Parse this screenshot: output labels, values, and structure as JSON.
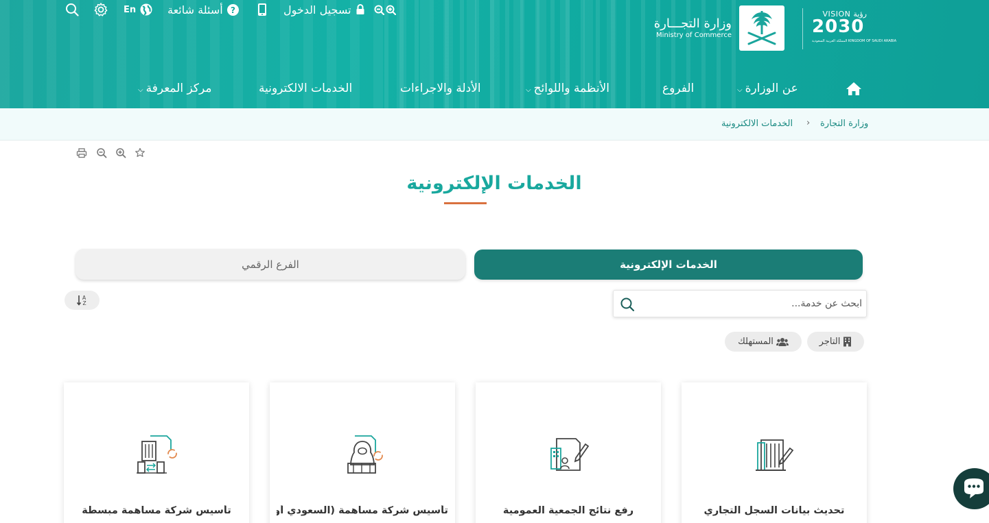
{
  "topbar": {
    "login_label": "تسجيل الدخول",
    "faq_label": "أسئلة شائعة",
    "language_label": "En"
  },
  "logo": {
    "ministry_ar": "وزارة التجـــارة",
    "ministry_en": "Ministry of Commerce",
    "vision_label": "VISION رؤية",
    "vision_year": "2030",
    "vision_kingdom": "المملكة العربية السعودية KINGDOM OF SAUDI ARABIA"
  },
  "nav": {
    "items": [
      {
        "label": "عن الوزارة"
      },
      {
        "label": "الفروع"
      },
      {
        "label": "الأنظمة واللوائح"
      },
      {
        "label": "الأدلة والاجراءات"
      },
      {
        "label": "الخدمات الالكترونية"
      },
      {
        "label": "مركز المعرفة"
      }
    ]
  },
  "breadcrumb": {
    "home": "وزارة التجارة",
    "current": "الخدمات الالكترونية"
  },
  "page": {
    "title": "الخدمات الإلكترونية"
  },
  "tabs": {
    "active": "الخدمات الإلكترونية",
    "inactive": "الفرع الرقمي"
  },
  "search": {
    "placeholder": "ابحث عن خدمة..."
  },
  "sort": {
    "label": "AZ"
  },
  "filters": [
    {
      "label": "التاجر",
      "icon": "building-icon"
    },
    {
      "label": "المستهلك",
      "icon": "users-icon"
    }
  ],
  "cards": [
    {
      "title": "تحديث بيانات السجل التجاري",
      "icon": "building-edit-icon"
    },
    {
      "title": "رفع نتائج الجمعية العمومية",
      "icon": "document-edit-icon"
    },
    {
      "title": "تأسيس شركة مساهمة (السعودي أو",
      "icon": "person-refresh-icon"
    },
    {
      "title": "تأسيس شركة مساهمة مبسطة",
      "icon": "buildings-refresh-icon"
    }
  ],
  "colors": {
    "brand_teal": "#19a89e",
    "tab_active": "#1b7d76",
    "title_underline": "#d9713f",
    "chat_bubble": "#153e3b"
  }
}
